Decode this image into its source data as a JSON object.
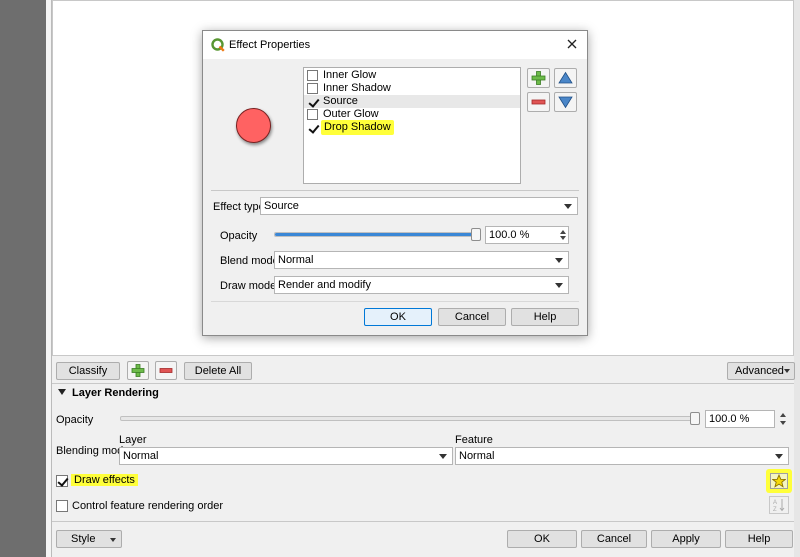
{
  "dialog": {
    "title": "Effect Properties",
    "effects": [
      {
        "label": "Inner Glow",
        "checked": false
      },
      {
        "label": "Inner Shadow",
        "checked": false
      },
      {
        "label": "Source",
        "checked": true,
        "selected": true
      },
      {
        "label": "Outer Glow",
        "checked": false
      },
      {
        "label": "Drop Shadow",
        "checked": true,
        "highlighted": true
      }
    ],
    "effect_type_label": "Effect type",
    "effect_type_value": "Source",
    "opacity_label": "Opacity",
    "opacity_value": "100.0 %",
    "opacity_fraction": 1.0,
    "blend_mode_label": "Blend mode",
    "blend_mode_value": "Normal",
    "draw_mode_label": "Draw mode",
    "draw_mode_value": "Render and modify",
    "ok_label": "OK",
    "cancel_label": "Cancel",
    "help_label": "Help",
    "preview_color": "#ff6262"
  },
  "toolbar": {
    "classify_label": "Classify",
    "delete_all_label": "Delete All",
    "advanced_label": "Advanced"
  },
  "layer_rendering": {
    "section_title": "Layer Rendering",
    "opacity_label": "Opacity",
    "opacity_value": "100.0 %",
    "opacity_fraction": 1.0,
    "blending_mode_label": "Blending mode",
    "layer_label": "Layer",
    "layer_value": "Normal",
    "feature_label": "Feature",
    "feature_value": "Normal",
    "draw_effects_label": "Draw effects",
    "draw_effects_checked": true,
    "control_order_label": "Control feature rendering order",
    "control_order_checked": false
  },
  "bottom_bar": {
    "style_label": "Style",
    "ok_label": "OK",
    "cancel_label": "Cancel",
    "apply_label": "Apply",
    "help_label": "Help"
  },
  "colors": {
    "highlight": "#ffff3a",
    "accent": "#0078d7",
    "qgis_green": "#589632"
  }
}
